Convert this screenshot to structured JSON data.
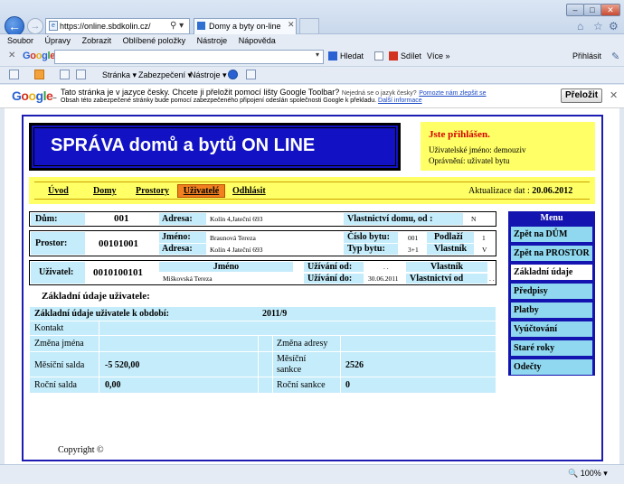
{
  "browser": {
    "address": "https://online.sbdkolin.cz/",
    "tab_title": "Domy a byty on-line",
    "menu": [
      "Soubor",
      "Úpravy",
      "Zobrazit",
      "Oblíbené položky",
      "Nástroje",
      "Nápověda"
    ],
    "google_toolbar": {
      "logo": "Google",
      "search": "Hledat",
      "share": "Sdílet",
      "more": "Více »",
      "signin": "Přihlásit"
    },
    "command_bar": {
      "page": "Stránka",
      "security": "Zabezpečení",
      "tools": "Nástroje"
    },
    "translate_bar": {
      "logo": "Google",
      "message": "Tato stránka je v jazyce česky. Chcete ji přeložit pomocí lišty Google Toolbar?",
      "not_czech": "Nejedná se o jazyk česky?",
      "help_link": "Pomozte nám zlepšit se",
      "note": "Obsah této zabezpečené stránky bude pomocí zabezpečeného připojení odeslán společnosti Google k překladu.",
      "info_link": "Další informace",
      "button": "Přeložit"
    },
    "zoom": "100%"
  },
  "header": {
    "title": "SPRÁVA domů a bytů ON LINE"
  },
  "login": {
    "title": "Jste přihlášen.",
    "user": "Uživatelské jméno: demouziv",
    "permission": "Oprávnění: uživatel bytu"
  },
  "nav": {
    "items": [
      "Úvod",
      "Domy",
      "Prostory",
      "Uživatelé",
      "Odhlásit"
    ],
    "update_label": "Aktualizace dat :",
    "update_date": "20.06.2012"
  },
  "dum": {
    "label": "Dům:",
    "value": "001",
    "address_label": "Adresa:",
    "address": "Kolín 4,Jateční 693",
    "ownership_label": "Vlastnictví domu, od :",
    "ownership": "N"
  },
  "prostor": {
    "label": "Prostor:",
    "value": "00101001",
    "name_label": "Jméno:",
    "name": "Braunová Tereza",
    "address_label": "Adresa:",
    "address": "Kolín 4 Jateční 693",
    "number_label": "Číslo bytu:",
    "number": "001",
    "floor_label": "Podlaží",
    "floor": "1",
    "type_label": "Typ bytu:",
    "type": "3+1",
    "owner_label": "Vlastník",
    "owner": "V"
  },
  "uzivatel": {
    "label": "Uživatel:",
    "value": "0010100101",
    "name_header": "Jméno",
    "name": "Miškovská Tereza",
    "from_label": "Užívání od:",
    "from": ". .",
    "to_label": "Užívání do:",
    "to": "30.06.2011",
    "owner_header": "Vlastník",
    "ownership_from_label": "Vlastnictví od",
    "ownership_from": ". ."
  },
  "menu": {
    "title": "Menu",
    "items": [
      "Zpět na DŮM",
      "Zpět na PROSTOR",
      "Základní údaje",
      "Předpisy",
      "Platby",
      "Vyúčtování",
      "Staré roky",
      "Odečty"
    ]
  },
  "basic": {
    "section_title": "Základní údaje uživatele:",
    "period_label": "Základní údaje uživatele k období:",
    "period": "2011/9",
    "contact_label": "Kontakt",
    "name_change_label": "Změna jména",
    "address_change_label": "Změna adresy",
    "monthly_balance_label": "Měsíční salda",
    "monthly_balance": "-5 520,00",
    "monthly_penalty_label_1": "Měsíční",
    "monthly_penalty_label_2": "sankce",
    "monthly_penalty": "2526",
    "annual_balance_label": "Roční salda",
    "annual_balance": "0,00",
    "annual_penalty_label": "Roční sankce",
    "annual_penalty": "0"
  },
  "footer": {
    "copyright": "Copyright ©"
  }
}
